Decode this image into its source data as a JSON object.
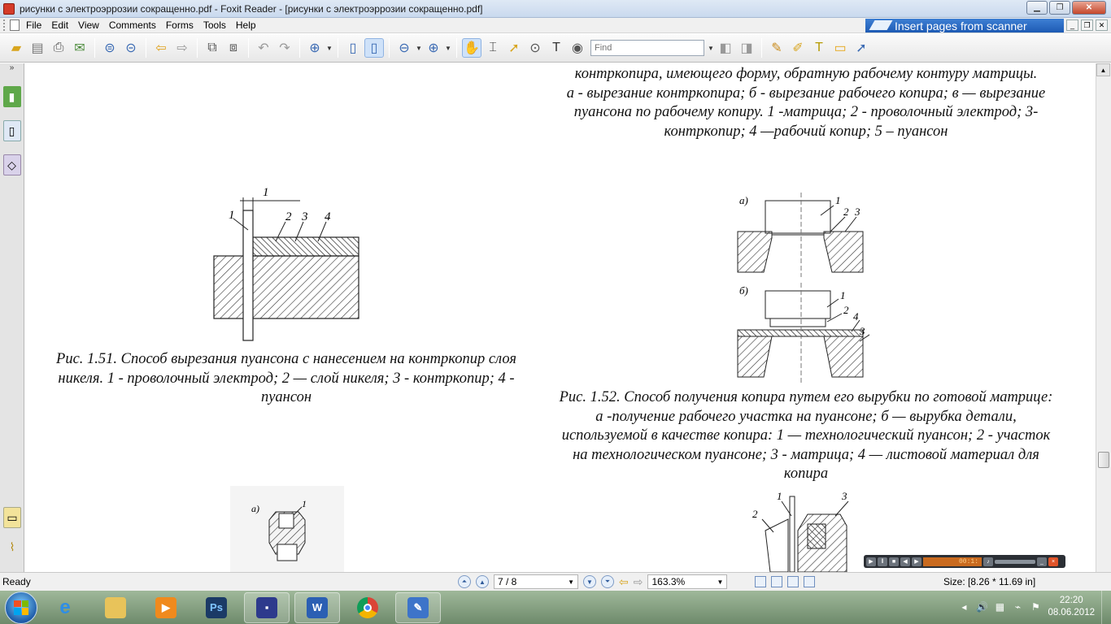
{
  "window": {
    "title": "рисунки с электроэррозии сокращенно.pdf - Foxit Reader - [рисунки с электроэррозии сокращенно.pdf]"
  },
  "menu": {
    "items": [
      "File",
      "Edit",
      "View",
      "Comments",
      "Forms",
      "Tools",
      "Help"
    ],
    "banner": "Insert pages from scanner"
  },
  "toolbar": {
    "find_placeholder": "Find"
  },
  "document": {
    "caption_top_right": "контркопира, имеющего форму, обратную рабочему контуру матрицы.\nа - вырезание контркопира; б - вырезание рабочего копира; в — вырезание пуансона по рабочему копиру. 1 -матрица; 2 - проволочный электрод; 3- контркопир; 4 —рабочий копир; 5 – пуансон",
    "fig151_caption": "Рис. 1.51. Способ вырезания пуансона с нанесением на контркопир слоя никеля. 1 - проволочный электрод; 2 — слой никеля; 3 - контркопир; 4 - пуансон",
    "fig152_caption": "Рис. 1.52. Способ получения копира путем его вырубки по готовой матрице: а -получение рабочего участка на пуансоне; б — вырубка детали, используемой в качестве копира: 1 — технологический пуансон; 2 - участок на технологическом пуансоне; 3 - матрица; 4 — листовой материал для копира",
    "fig151_labels": [
      "1",
      "1",
      "2",
      "3",
      "4"
    ],
    "fig152a_labels": [
      "а)",
      "1",
      "2",
      "3"
    ],
    "fig152b_labels": [
      "б)",
      "1",
      "2",
      "4",
      "3"
    ],
    "fig_bottom_left_labels": [
      "а)",
      "1"
    ],
    "fig_bottom_right_labels": [
      "1",
      "3",
      "2"
    ]
  },
  "player": {
    "time": "00:1:"
  },
  "statusbar": {
    "ready": "Ready",
    "page": "7 / 8",
    "zoom": "163.3%",
    "size": "Size: [8.26 * 11.69 in]"
  },
  "taskbar": {
    "time": "22:20",
    "date": "08.06.2012"
  }
}
